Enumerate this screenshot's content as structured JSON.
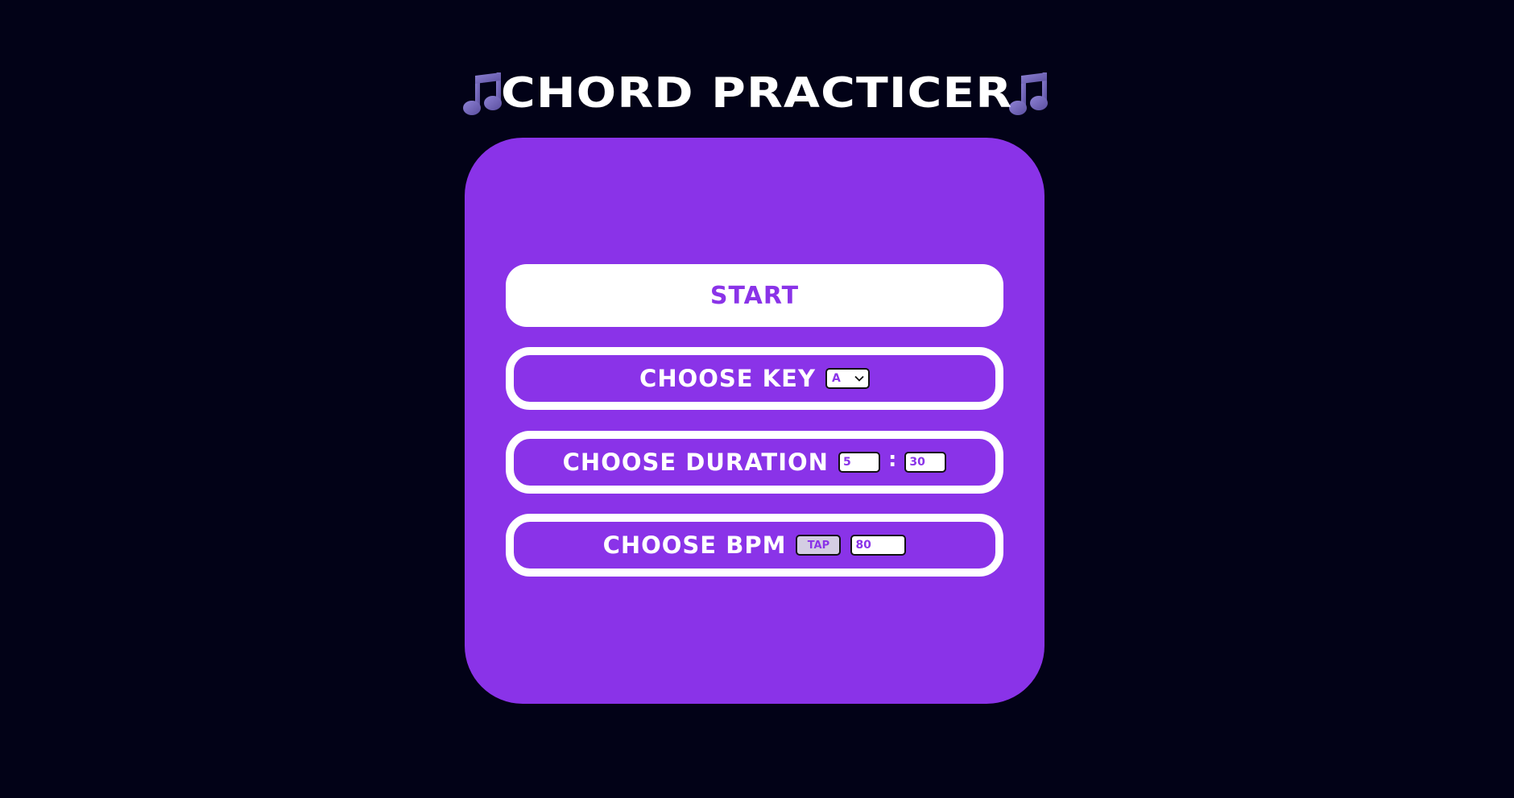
{
  "header": {
    "title": "CHORD PRACTICER",
    "left_icon": "musical-notes-icon",
    "right_icon": "musical-notes-icon"
  },
  "card": {
    "start_label": "START",
    "key": {
      "label": "CHOOSE KEY",
      "selected": "A"
    },
    "duration": {
      "label": "CHOOSE DURATION",
      "minutes": "5",
      "separator": ":",
      "seconds": "30"
    },
    "bpm": {
      "label": "CHOOSE BPM",
      "tap_label": "TAP",
      "value": "80"
    }
  },
  "colors": {
    "background": "#020217",
    "accent": "#8a33e8",
    "white": "#ffffff"
  }
}
